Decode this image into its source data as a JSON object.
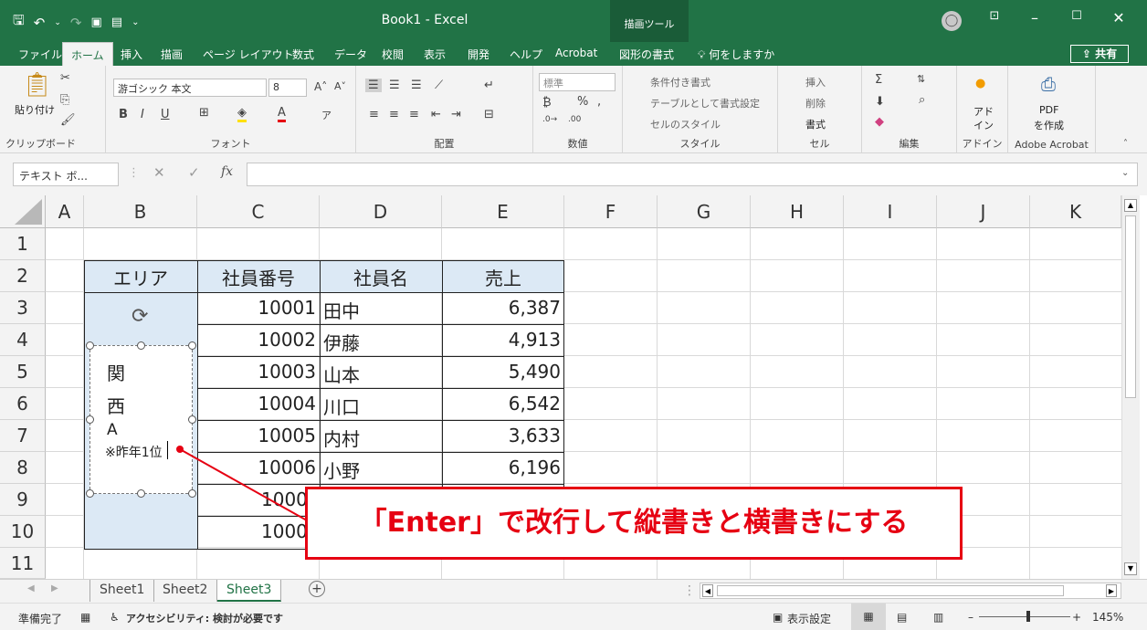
{
  "titlebar": {
    "title": "Book1  -  Excel",
    "context_tab": "描画ツール",
    "avatar": "◯"
  },
  "tabs": [
    {
      "label": "ファイル",
      "active": false
    },
    {
      "label": "ホーム",
      "active": true
    },
    {
      "label": "挿入",
      "active": false
    },
    {
      "label": "描画",
      "active": false
    },
    {
      "label": "ページ レイアウト",
      "active": false
    },
    {
      "label": "数式",
      "active": false
    },
    {
      "label": "データ",
      "active": false
    },
    {
      "label": "校閲",
      "active": false
    },
    {
      "label": "表示",
      "active": false
    },
    {
      "label": "開発",
      "active": false
    },
    {
      "label": "ヘルプ",
      "active": false
    },
    {
      "label": "Acrobat",
      "active": false
    },
    {
      "label": "図形の書式",
      "active": false
    }
  ],
  "tellme": "何をしますか",
  "share": "共有",
  "ribbon": {
    "clipboard": {
      "paste": "貼り付け",
      "label": "クリップボード"
    },
    "font": {
      "name": "游ゴシック 本文",
      "size": "8",
      "label": "フォント"
    },
    "alignment": {
      "label": "配置"
    },
    "number": {
      "format": "標準",
      "label": "数値"
    },
    "styles": {
      "conditional": "条件付き書式",
      "table": "テーブルとして書式設定",
      "cell": "セルのスタイル",
      "label": "スタイル"
    },
    "cells": {
      "insert": "挿入",
      "delete": "削除",
      "format": "書式",
      "label": "セル"
    },
    "editing": {
      "label": "編集"
    },
    "addins": {
      "line1": "アド",
      "line2": "イン",
      "label": "アドイン"
    },
    "acrobat": {
      "line1": "PDF",
      "line2": "を作成",
      "label": "Adobe Acrobat"
    }
  },
  "namebox": "テキスト ボ...",
  "columns": [
    "A",
    "B",
    "C",
    "D",
    "E",
    "F",
    "G",
    "H",
    "I",
    "J",
    "K"
  ],
  "rows": [
    "1",
    "2",
    "3",
    "4",
    "5",
    "6",
    "7",
    "8",
    "9",
    "10",
    "11"
  ],
  "table": {
    "headers": [
      "エリア",
      "社員番号",
      "社員名",
      "売上"
    ],
    "rows": [
      {
        "id": "10001",
        "name": "田中",
        "sales": "6,387"
      },
      {
        "id": "10002",
        "name": "伊藤",
        "sales": "4,913"
      },
      {
        "id": "10003",
        "name": "山本",
        "sales": "5,490"
      },
      {
        "id": "10004",
        "name": "川口",
        "sales": "6,542"
      },
      {
        "id": "10005",
        "name": "内村",
        "sales": "3,633"
      },
      {
        "id": "10006",
        "name": "小野",
        "sales": "6,196"
      },
      {
        "id": "1000",
        "name": "",
        "sales": ""
      },
      {
        "id": "1000",
        "name": "",
        "sales": ""
      }
    ]
  },
  "shape_text": {
    "line1": "関",
    "line2": "西",
    "line3": "A",
    "line4": "※昨年1位"
  },
  "callout": "「Enter」で改行して縦書きと横書きにする",
  "sheets": [
    {
      "label": "Sheet1",
      "active": false
    },
    {
      "label": "Sheet2",
      "active": false
    },
    {
      "label": "Sheet3",
      "active": true
    }
  ],
  "status": {
    "ready": "準備完了",
    "accessibility": "アクセシビリティ: 検討が必要です",
    "display_settings": "表示設定",
    "zoom": "145%"
  },
  "colors": {
    "excel_green": "#217346",
    "callout_red": "#e60012",
    "table_fill": "#dce9f5"
  }
}
